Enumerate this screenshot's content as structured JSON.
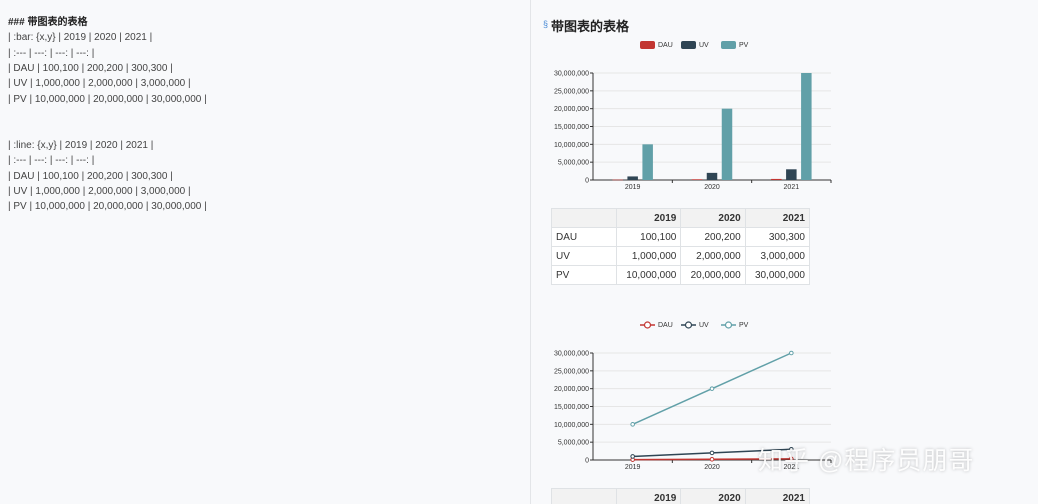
{
  "editor": {
    "lines": [
      "### 带图表的表格",
      "| :bar: {x,y} | 2019 | 2020 | 2021 |",
      "| :--- | ---: | ---: | ---: |",
      "| DAU | 100,100 | 200,200 | 300,300 |",
      "| UV | 1,000,000 | 2,000,000 | 3,000,000 |",
      "| PV | 10,000,000 | 20,000,000 | 30,000,000 |",
      "",
      "",
      "| :line: {x,y} | 2019 | 2020 | 2021 |",
      "| :--- | ---: | ---: | ---: |",
      "| DAU | 100,100 | 200,200 | 300,300 |",
      "| UV | 1,000,000 | 2,000,000 | 3,000,000 |",
      "| PV | 10,000,000 | 20,000,000 | 30,000,000 |"
    ]
  },
  "preview": {
    "anchor_icon": "link-icon",
    "heading": "带图表的表格",
    "table": {
      "headers": [
        "",
        "2019",
        "2020",
        "2021"
      ],
      "rows": [
        [
          "DAU",
          "100,100",
          "200,200",
          "300,300"
        ],
        [
          "UV",
          "1,000,000",
          "2,000,000",
          "3,000,000"
        ],
        [
          "PV",
          "10,000,000",
          "20,000,000",
          "30,000,000"
        ]
      ]
    },
    "table2_headers": [
      "",
      "2019",
      "2020",
      "2021"
    ]
  },
  "watermark": "知乎 @程序员朋哥",
  "chart_data": [
    {
      "type": "bar",
      "categories": [
        "2019",
        "2020",
        "2021"
      ],
      "series": [
        {
          "name": "DAU",
          "values": [
            100100,
            200200,
            300300
          ],
          "color": "#c23531"
        },
        {
          "name": "UV",
          "values": [
            1000000,
            2000000,
            3000000
          ],
          "color": "#2f4554"
        },
        {
          "name": "PV",
          "values": [
            10000000,
            20000000,
            30000000
          ],
          "color": "#61a0a8"
        }
      ],
      "ylim": [
        0,
        30000000
      ],
      "yticks": [
        "0",
        "5,000,000",
        "10,000,000",
        "15,000,000",
        "20,000,000",
        "25,000,000",
        "30,000,000"
      ],
      "legend": "top-center",
      "grid": true
    },
    {
      "type": "line",
      "categories": [
        "2019",
        "2020",
        "2021"
      ],
      "series": [
        {
          "name": "DAU",
          "values": [
            100100,
            200200,
            300300
          ],
          "color": "#c23531"
        },
        {
          "name": "UV",
          "values": [
            1000000,
            2000000,
            3000000
          ],
          "color": "#2f4554"
        },
        {
          "name": "PV",
          "values": [
            10000000,
            20000000,
            30000000
          ],
          "color": "#61a0a8"
        }
      ],
      "ylim": [
        0,
        30000000
      ],
      "yticks": [
        "0",
        "5,000,000",
        "10,000,000",
        "15,000,000",
        "20,000,000",
        "25,000,000",
        "30,000,000"
      ],
      "legend": "top-center",
      "grid": true
    }
  ]
}
